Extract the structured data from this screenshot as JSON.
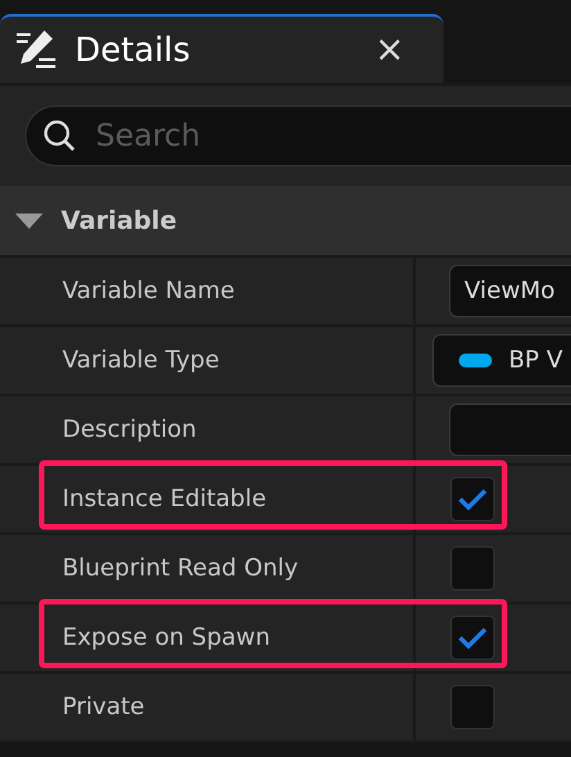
{
  "tab": {
    "title": "Details",
    "close": "×"
  },
  "search": {
    "placeholder": "Search"
  },
  "section": {
    "title": "Variable",
    "expanded": true
  },
  "rows": [
    {
      "label": "Variable Name",
      "kind": "text",
      "value": "ViewMo",
      "highlighted": false
    },
    {
      "label": "Variable Type",
      "kind": "type",
      "value": "BP V",
      "color": "#00a8f0",
      "highlighted": false
    },
    {
      "label": "Description",
      "kind": "text",
      "highlighted": false
    },
    {
      "label": "Instance Editable",
      "kind": "checkbox",
      "checked": true,
      "highlighted": true
    },
    {
      "label": "Blueprint Read Only",
      "kind": "checkbox",
      "checked": false,
      "highlighted": false
    },
    {
      "label": "Expose on Spawn",
      "kind": "checkbox",
      "checked": true,
      "highlighted": true
    },
    {
      "label": "Private",
      "kind": "checkbox",
      "checked": false,
      "highlighted": false
    }
  ]
}
